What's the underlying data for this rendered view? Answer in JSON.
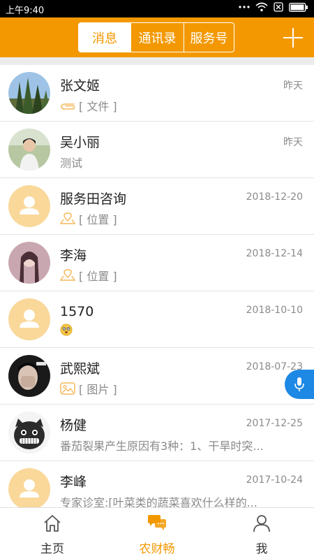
{
  "status_bar": {
    "time": "上午9:40"
  },
  "header": {
    "tabs": [
      {
        "label": "消息",
        "active": true
      },
      {
        "label": "通讯录",
        "active": false
      },
      {
        "label": "服务号",
        "active": false
      }
    ],
    "add_icon": "plus-icon"
  },
  "conversations": [
    {
      "name": "张文姬",
      "time": "昨天",
      "preview": "[ 文件 ]",
      "preview_icon": "attachment-icon",
      "avatar": "photo-trees"
    },
    {
      "name": "吴小丽",
      "time": "昨天",
      "preview": "测试",
      "preview_icon": "",
      "avatar": "photo-person"
    },
    {
      "name": "服务田咨询",
      "time": "2018-12-20",
      "preview": "[ 位置 ]",
      "preview_icon": "location-icon",
      "avatar": "default-avatar"
    },
    {
      "name": "李海",
      "time": "2018-12-14",
      "preview": "[ 位置 ]",
      "preview_icon": "location-icon",
      "avatar": "photo-portrait"
    },
    {
      "name": "1570",
      "time": "2018-10-10",
      "preview": "",
      "preview_icon": "emoji-icon",
      "avatar": "default-avatar"
    },
    {
      "name": "武熙斌",
      "time": "2018-07-23",
      "preview": "[ 图片 ]",
      "preview_icon": "image-icon",
      "avatar": "photo-face"
    },
    {
      "name": "杨健",
      "time": "2017-12-25",
      "preview": "番茄裂果产生原因有3种：1、干旱时突...",
      "preview_icon": "",
      "avatar": "photo-cartoon"
    },
    {
      "name": "李峰",
      "time": "2017-10-24",
      "preview": "专家诊室:[叶菜类的蔬菜喜欢什么样的...",
      "preview_icon": "",
      "avatar": "default-avatar"
    }
  ],
  "tabbar": {
    "items": [
      {
        "label": "主页",
        "icon": "home-icon",
        "active": false
      },
      {
        "label": "农财畅",
        "icon": "chat-bubbles-icon",
        "active": true
      },
      {
        "label": "我",
        "icon": "person-icon",
        "active": false
      }
    ]
  },
  "colors": {
    "accent": "#f39800",
    "mic": "#1e88e5",
    "avatar_default": "#f9d89a"
  }
}
